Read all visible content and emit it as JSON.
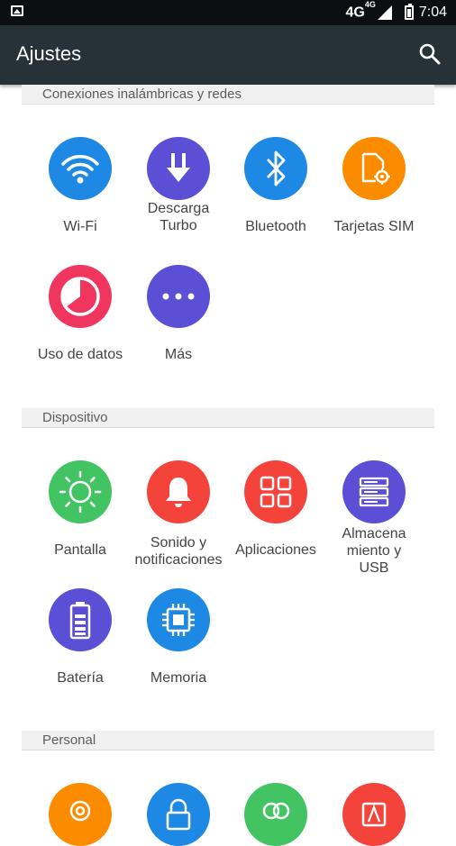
{
  "statusbar": {
    "network": "4G",
    "network_sup": "4G",
    "time": "7:04"
  },
  "appbar": {
    "title": "Ajustes"
  },
  "sections": [
    {
      "header": "Conexiones inalámbricas y redes",
      "items": [
        {
          "label": "Wi-Fi",
          "icon": "wifi-icon",
          "color": "#1e88e5"
        },
        {
          "label": "Descarga Turbo",
          "icon": "download-arrow-icon",
          "color": "#5b4fd6"
        },
        {
          "label": "Bluetooth",
          "icon": "bluetooth-icon",
          "color": "#1e88e5"
        },
        {
          "label": "Tarjetas SIM",
          "icon": "sim-card-icon",
          "color": "#fb8c00"
        },
        {
          "label": "Uso de datos",
          "icon": "data-usage-icon",
          "color": "#f0355e"
        },
        {
          "label": "Más",
          "icon": "more-dots-icon",
          "color": "#5b4fd6"
        }
      ]
    },
    {
      "header": "Dispositivo",
      "items": [
        {
          "label": "Pantalla",
          "icon": "brightness-icon",
          "color": "#43c463"
        },
        {
          "label": "Sonido y notificaciones",
          "icon": "bell-icon",
          "color": "#f4433a"
        },
        {
          "label": "Aplicaciones",
          "icon": "apps-grid-icon",
          "color": "#f4433a"
        },
        {
          "label": "Almacena miento y USB",
          "icon": "storage-icon",
          "color": "#5b4fd6"
        },
        {
          "label": "Batería",
          "icon": "battery-icon",
          "color": "#5b4fd6"
        },
        {
          "label": "Memoria",
          "icon": "memory-chip-icon",
          "color": "#1e88e5"
        }
      ]
    },
    {
      "header": "Personal",
      "items": [
        {
          "label": "",
          "icon": "location-icon",
          "color": "#fb8c00"
        },
        {
          "label": "",
          "icon": "lock-icon",
          "color": "#1e88e5"
        },
        {
          "label": "",
          "icon": "accounts-icon",
          "color": "#43c463"
        },
        {
          "label": "",
          "icon": "language-icon",
          "color": "#f4433a"
        }
      ]
    }
  ]
}
